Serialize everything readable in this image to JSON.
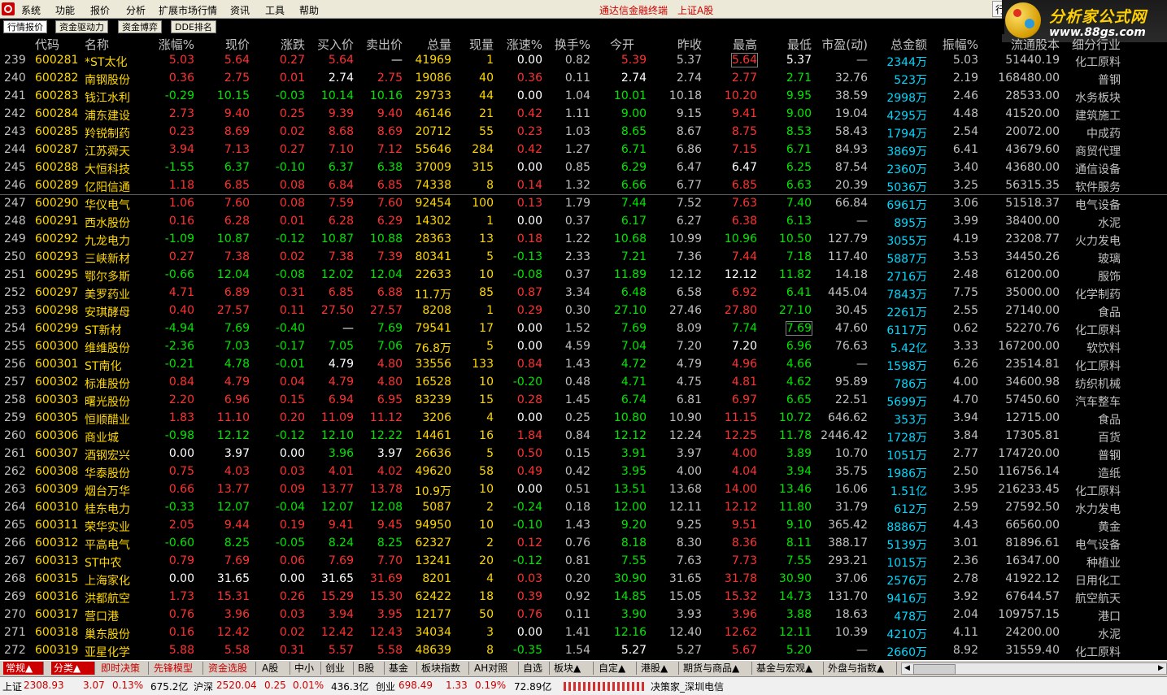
{
  "menu": {
    "items": [
      "系统",
      "功能",
      "报价",
      "分析",
      "扩展市场行情",
      "资讯",
      "工具",
      "帮助"
    ],
    "center_a": "通达信金融终端",
    "center_b": "上证A股",
    "corner": "行"
  },
  "brand": {
    "title": "分析家公式网",
    "url": "www.88gs.com"
  },
  "tabs": [
    "行情报价",
    "资金驱动力",
    "资金博弈",
    "DDE排名"
  ],
  "columns": [
    "代码",
    "名称",
    "涨幅%",
    "现价",
    "涨跌",
    "买入价",
    "卖出价",
    "总量",
    "现量",
    "涨速%",
    "换手%",
    "今开",
    "昨收",
    "最高",
    "最低",
    "市盈(动)",
    "总金额",
    "振幅%",
    "流通股本",
    "细分行业"
  ],
  "rows": [
    [
      "239",
      "600281",
      "*ST太化",
      "5.03",
      "5.64",
      "0.27",
      "5.64",
      "—",
      "41969",
      "1",
      "0.00",
      "0.82",
      "5.39",
      "5.37",
      "5.64",
      "5.37",
      "—",
      "2344万",
      "5.03",
      "51440.19",
      "化工原料"
    ],
    [
      "240",
      "600282",
      "南钢股份",
      "0.36",
      "2.75",
      "0.01",
      "2.74",
      "2.75",
      "19086",
      "40",
      "0.36",
      "0.11",
      "2.74",
      "2.74",
      "2.77",
      "2.71",
      "32.76",
      "523万",
      "2.19",
      "168480.00",
      "普钢"
    ],
    [
      "241",
      "600283",
      "钱江水利",
      "-0.29",
      "10.15",
      "-0.03",
      "10.14",
      "10.16",
      "29733",
      "44",
      "0.00",
      "1.04",
      "10.01",
      "10.18",
      "10.20",
      "9.95",
      "38.59",
      "2998万",
      "2.46",
      "28533.00",
      "水务板块"
    ],
    [
      "242",
      "600284",
      "浦东建设",
      "2.73",
      "9.40",
      "0.25",
      "9.39",
      "9.40",
      "46146",
      "21",
      "0.42",
      "1.11",
      "9.00",
      "9.15",
      "9.41",
      "9.00",
      "19.04",
      "4295万",
      "4.48",
      "41520.00",
      "建筑施工"
    ],
    [
      "243",
      "600285",
      "羚锐制药",
      "0.23",
      "8.69",
      "0.02",
      "8.68",
      "8.69",
      "20712",
      "55",
      "0.23",
      "1.03",
      "8.65",
      "8.67",
      "8.75",
      "8.53",
      "58.43",
      "1794万",
      "2.54",
      "20072.00",
      "中成药"
    ],
    [
      "244",
      "600287",
      "江苏舜天",
      "3.94",
      "7.13",
      "0.27",
      "7.10",
      "7.12",
      "55646",
      "284",
      "0.42",
      "1.27",
      "6.71",
      "6.86",
      "7.15",
      "6.71",
      "84.93",
      "3869万",
      "6.41",
      "43679.60",
      "商贸代理"
    ],
    [
      "245",
      "600288",
      "大恒科技",
      "-1.55",
      "6.37",
      "-0.10",
      "6.37",
      "6.38",
      "37009",
      "315",
      "0.00",
      "0.85",
      "6.29",
      "6.47",
      "6.47",
      "6.25",
      "87.54",
      "2360万",
      "3.40",
      "43680.00",
      "通信设备"
    ],
    [
      "246",
      "600289",
      "亿阳信通",
      "1.18",
      "6.85",
      "0.08",
      "6.84",
      "6.85",
      "74338",
      "8",
      "0.14",
      "1.32",
      "6.66",
      "6.77",
      "6.85",
      "6.63",
      "20.39",
      "5036万",
      "3.25",
      "56315.35",
      "软件服务"
    ],
    [
      "247",
      "600290",
      "华仪电气",
      "1.06",
      "7.60",
      "0.08",
      "7.59",
      "7.60",
      "92454",
      "100",
      "0.13",
      "1.79",
      "7.44",
      "7.52",
      "7.63",
      "7.40",
      "66.84",
      "6961万",
      "3.06",
      "51518.37",
      "电气设备"
    ],
    [
      "248",
      "600291",
      "西水股份",
      "0.16",
      "6.28",
      "0.01",
      "6.28",
      "6.29",
      "14302",
      "1",
      "0.00",
      "0.37",
      "6.17",
      "6.27",
      "6.38",
      "6.13",
      "—",
      "895万",
      "3.99",
      "38400.00",
      "水泥"
    ],
    [
      "249",
      "600292",
      "九龙电力",
      "-1.09",
      "10.87",
      "-0.12",
      "10.87",
      "10.88",
      "28363",
      "13",
      "0.18",
      "1.22",
      "10.68",
      "10.99",
      "10.96",
      "10.50",
      "127.79",
      "3055万",
      "4.19",
      "23208.77",
      "火力发电"
    ],
    [
      "250",
      "600293",
      "三峡新材",
      "0.27",
      "7.38",
      "0.02",
      "7.38",
      "7.39",
      "80341",
      "5",
      "-0.13",
      "2.33",
      "7.21",
      "7.36",
      "7.44",
      "7.18",
      "117.40",
      "5887万",
      "3.53",
      "34450.26",
      "玻璃"
    ],
    [
      "251",
      "600295",
      "鄂尔多斯",
      "-0.66",
      "12.04",
      "-0.08",
      "12.02",
      "12.04",
      "22633",
      "10",
      "-0.08",
      "0.37",
      "11.89",
      "12.12",
      "12.12",
      "11.82",
      "14.18",
      "2716万",
      "2.48",
      "61200.00",
      "服饰"
    ],
    [
      "252",
      "600297",
      "美罗药业",
      "4.71",
      "6.89",
      "0.31",
      "6.85",
      "6.88",
      "11.7万",
      "85",
      "0.87",
      "3.34",
      "6.48",
      "6.58",
      "6.92",
      "6.41",
      "445.04",
      "7843万",
      "7.75",
      "35000.00",
      "化学制药"
    ],
    [
      "253",
      "600298",
      "安琪酵母",
      "0.40",
      "27.57",
      "0.11",
      "27.50",
      "27.57",
      "8208",
      "1",
      "0.29",
      "0.30",
      "27.10",
      "27.46",
      "27.80",
      "27.10",
      "30.45",
      "2261万",
      "2.55",
      "27140.00",
      "食品"
    ],
    [
      "254",
      "600299",
      "ST新材",
      "-4.94",
      "7.69",
      "-0.40",
      "—",
      "7.69",
      "79541",
      "17",
      "0.00",
      "1.52",
      "7.69",
      "8.09",
      "7.74",
      "7.69",
      "47.60",
      "6117万",
      "0.62",
      "52270.76",
      "化工原料"
    ],
    [
      "255",
      "600300",
      "维维股份",
      "-2.36",
      "7.03",
      "-0.17",
      "7.05",
      "7.06",
      "76.8万",
      "5",
      "0.00",
      "4.59",
      "7.04",
      "7.20",
      "7.20",
      "6.96",
      "76.63",
      "5.42亿",
      "3.33",
      "167200.00",
      "软饮料"
    ],
    [
      "256",
      "600301",
      "ST南化",
      "-0.21",
      "4.78",
      "-0.01",
      "4.79",
      "4.80",
      "33556",
      "133",
      "0.84",
      "1.43",
      "4.72",
      "4.79",
      "4.96",
      "4.66",
      "—",
      "1598万",
      "6.26",
      "23514.81",
      "化工原料"
    ],
    [
      "257",
      "600302",
      "标准股份",
      "0.84",
      "4.79",
      "0.04",
      "4.79",
      "4.80",
      "16528",
      "10",
      "-0.20",
      "0.48",
      "4.71",
      "4.75",
      "4.81",
      "4.62",
      "95.89",
      "786万",
      "4.00",
      "34600.98",
      "纺织机械"
    ],
    [
      "258",
      "600303",
      "曙光股份",
      "2.20",
      "6.96",
      "0.15",
      "6.94",
      "6.95",
      "83239",
      "15",
      "0.28",
      "1.45",
      "6.74",
      "6.81",
      "6.97",
      "6.65",
      "22.51",
      "5699万",
      "4.70",
      "57450.60",
      "汽车整车"
    ],
    [
      "259",
      "600305",
      "恒顺醋业",
      "1.83",
      "11.10",
      "0.20",
      "11.09",
      "11.12",
      "3206",
      "4",
      "0.00",
      "0.25",
      "10.80",
      "10.90",
      "11.15",
      "10.72",
      "646.62",
      "353万",
      "3.94",
      "12715.00",
      "食品"
    ],
    [
      "260",
      "600306",
      "商业城",
      "-0.98",
      "12.12",
      "-0.12",
      "12.10",
      "12.22",
      "14461",
      "16",
      "1.84",
      "0.84",
      "12.12",
      "12.24",
      "12.25",
      "11.78",
      "2446.42",
      "1728万",
      "3.84",
      "17305.81",
      "百货"
    ],
    [
      "261",
      "600307",
      "酒钢宏兴",
      "0.00",
      "3.97",
      "0.00",
      "3.96",
      "3.97",
      "26636",
      "5",
      "0.50",
      "0.15",
      "3.91",
      "3.97",
      "4.00",
      "3.89",
      "10.70",
      "1051万",
      "2.77",
      "174720.00",
      "普钢"
    ],
    [
      "262",
      "600308",
      "华泰股份",
      "0.75",
      "4.03",
      "0.03",
      "4.01",
      "4.02",
      "49620",
      "58",
      "0.49",
      "0.42",
      "3.95",
      "4.00",
      "4.04",
      "3.94",
      "35.75",
      "1986万",
      "2.50",
      "116756.14",
      "造纸"
    ],
    [
      "263",
      "600309",
      "烟台万华",
      "0.66",
      "13.77",
      "0.09",
      "13.77",
      "13.78",
      "10.9万",
      "10",
      "0.00",
      "0.51",
      "13.51",
      "13.68",
      "14.00",
      "13.46",
      "16.06",
      "1.51亿",
      "3.95",
      "216233.45",
      "化工原料"
    ],
    [
      "264",
      "600310",
      "桂东电力",
      "-0.33",
      "12.07",
      "-0.04",
      "12.07",
      "12.08",
      "5087",
      "2",
      "-0.24",
      "0.18",
      "12.00",
      "12.11",
      "12.12",
      "11.80",
      "31.79",
      "612万",
      "2.59",
      "27592.50",
      "水力发电"
    ],
    [
      "265",
      "600311",
      "荣华实业",
      "2.05",
      "9.44",
      "0.19",
      "9.41",
      "9.45",
      "94950",
      "10",
      "-0.10",
      "1.43",
      "9.20",
      "9.25",
      "9.51",
      "9.10",
      "365.42",
      "8886万",
      "4.43",
      "66560.00",
      "黄金"
    ],
    [
      "266",
      "600312",
      "平高电气",
      "-0.60",
      "8.25",
      "-0.05",
      "8.24",
      "8.25",
      "62327",
      "2",
      "0.12",
      "0.76",
      "8.18",
      "8.30",
      "8.36",
      "8.11",
      "388.17",
      "5139万",
      "3.01",
      "81896.61",
      "电气设备"
    ],
    [
      "267",
      "600313",
      "ST中农",
      "0.79",
      "7.69",
      "0.06",
      "7.69",
      "7.70",
      "13241",
      "20",
      "-0.12",
      "0.81",
      "7.55",
      "7.63",
      "7.73",
      "7.55",
      "293.21",
      "1015万",
      "2.36",
      "16347.00",
      "种植业"
    ],
    [
      "268",
      "600315",
      "上海家化",
      "0.00",
      "31.65",
      "0.00",
      "31.65",
      "31.69",
      "8201",
      "4",
      "0.03",
      "0.20",
      "30.90",
      "31.65",
      "31.78",
      "30.90",
      "37.06",
      "2576万",
      "2.78",
      "41922.12",
      "日用化工"
    ],
    [
      "269",
      "600316",
      "洪都航空",
      "1.73",
      "15.31",
      "0.26",
      "15.29",
      "15.30",
      "62422",
      "18",
      "0.39",
      "0.92",
      "14.85",
      "15.05",
      "15.32",
      "14.73",
      "131.70",
      "9416万",
      "3.92",
      "67644.57",
      "航空航天"
    ],
    [
      "270",
      "600317",
      "营口港",
      "0.76",
      "3.96",
      "0.03",
      "3.94",
      "3.95",
      "12177",
      "50",
      "0.76",
      "0.11",
      "3.90",
      "3.93",
      "3.96",
      "3.88",
      "18.63",
      "478万",
      "2.04",
      "109757.15",
      "港口"
    ],
    [
      "271",
      "600318",
      "巢东股份",
      "0.16",
      "12.42",
      "0.02",
      "12.42",
      "12.43",
      "34034",
      "3",
      "0.00",
      "1.41",
      "12.16",
      "12.40",
      "12.62",
      "12.11",
      "10.39",
      "4210万",
      "4.11",
      "24200.00",
      "水泥"
    ],
    [
      "272",
      "600319",
      "亚星化学",
      "5.88",
      "5.58",
      "0.31",
      "5.57",
      "5.58",
      "48639",
      "8",
      "-0.35",
      "1.54",
      "5.27",
      "5.27",
      "5.67",
      "5.20",
      "—",
      "2660万",
      "8.92",
      "31559.40",
      "化工原料"
    ]
  ],
  "bottom_tabs": [
    "常规▲",
    "分类▲",
    "即时决策",
    "先锋模型",
    "资金选股",
    "A股",
    "中小",
    "创业",
    "B股",
    "基金",
    "板块指数",
    "AH对照",
    "自选",
    "板块▲",
    "自定▲",
    "港股▲",
    "期货与商品▲",
    "基金与宏观▲",
    "外盘与指数▲"
  ],
  "status": {
    "sh_label": "上证",
    "sh_value": "2308.93",
    "sh_change": "3.07",
    "sh_pct": "0.13%",
    "sh_amount": "675.2亿",
    "sz_label": "沪深",
    "sz_value": "2520.04",
    "sz_change": "0.25",
    "sz_pct": "0.01%",
    "sz_amount": "436.3亿",
    "cy_label": "创业",
    "cy_value": "698.49",
    "cy_change": "1.33",
    "cy_pct": "0.19%",
    "cy_amount": "72.89亿",
    "server": "决策家_深圳电信"
  },
  "colors": {
    "up": "#ff3232",
    "down": "#00e600",
    "flat": "#ffffff",
    "code": "#ffd700",
    "amount": "#00d8ff",
    "bg": "#000000"
  }
}
